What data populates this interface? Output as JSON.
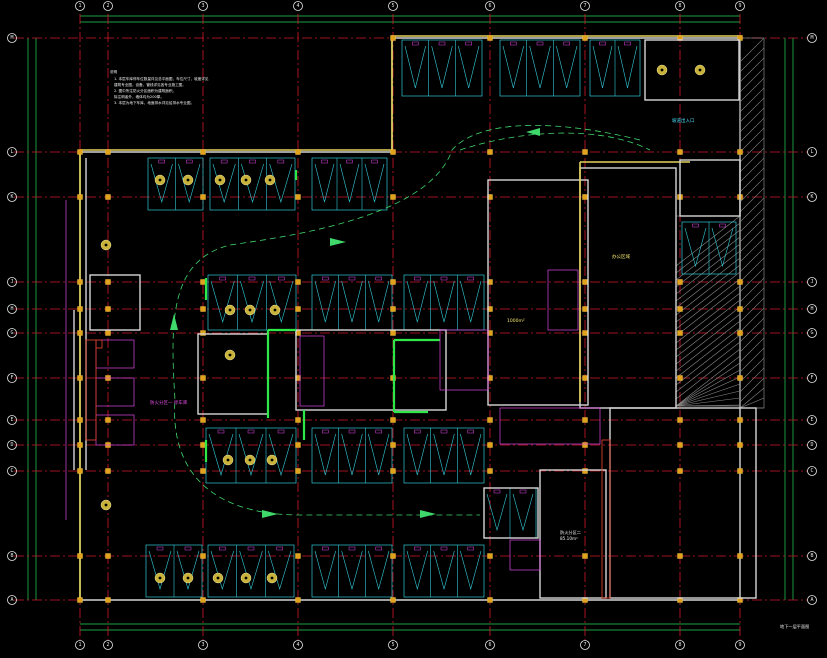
{
  "drawing": {
    "background": "#000000",
    "colors": {
      "grid": "#d11a2a",
      "dimension": "#29d65a",
      "wall": "#d6d6d6",
      "wall_highlight": "#e4d25a",
      "parking": "#31c8d6",
      "column": "#e2a31c",
      "accent_green": "#2ee84a",
      "accent_magenta": "#e045e6"
    },
    "axes_vertical": [
      "1",
      "2",
      "3",
      "4",
      "5",
      "6",
      "7",
      "8",
      "9"
    ],
    "axes_horizontal": [
      "M",
      "L",
      "K",
      "J",
      "H",
      "G",
      "F",
      "E",
      "D",
      "C",
      "B",
      "A"
    ],
    "notes_title": "说明",
    "notes": [
      "1. 本层车库停车位数量详见总平面图，车位尺寸，坡度详见",
      "   建筑专业图，设备、管线详见各专业施工图。",
      "2. 图中所注防火分区面积为建筑面积。",
      "   除注明者外，墙体均为200厚。",
      "3. 本层为地下车库，地面排水详见给排水专业图。"
    ],
    "labels": {
      "ramp": "坡道出入口",
      "fire_zone_1": "防火分区一 停车库",
      "area_1": "1000m²",
      "fire_zone_2": "防火分区二",
      "area_2": "85.10m²",
      "shop": "办公区域",
      "title_block": "地下一层平面图"
    }
  }
}
